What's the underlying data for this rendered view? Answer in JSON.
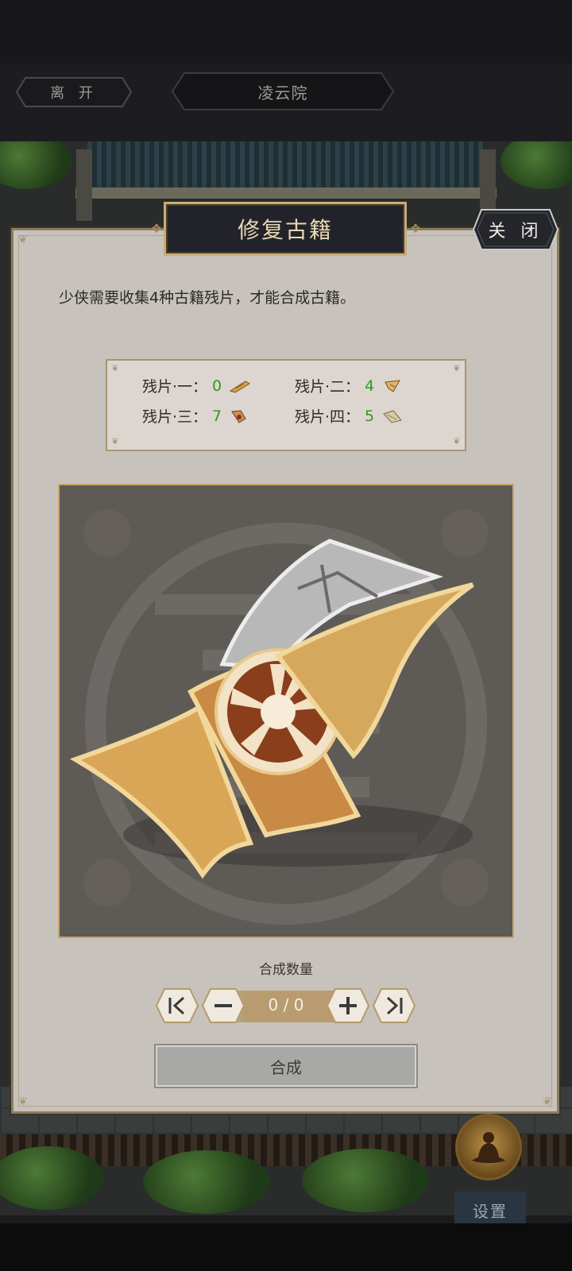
{
  "top_bar": {
    "leave_label": "离 开",
    "location_title": "凌云院"
  },
  "dialog": {
    "title": "修复古籍",
    "close_label": "关 闭",
    "instruction": "少侠需要收集4种古籍残片，才能合成古籍。",
    "fragments": [
      {
        "label": "残片·一：",
        "count": "0",
        "icon": "scroll-fragment-icon"
      },
      {
        "label": "残片·二：",
        "count": "4",
        "icon": "scroll-fragment-icon"
      },
      {
        "label": "残片·三：",
        "count": "7",
        "icon": "scroll-fragment-icon"
      },
      {
        "label": "残片·四：",
        "count": "5",
        "icon": "scroll-fragment-icon"
      }
    ],
    "quantity_label": "合成数量",
    "quantity_value": "0 / 0",
    "compose_label": "合成"
  },
  "side": {
    "settings_label": "设置"
  },
  "colors": {
    "count_green": "#2f9a1f",
    "gold": "#c7a66a",
    "panel_bg": "#c8c2bc"
  }
}
